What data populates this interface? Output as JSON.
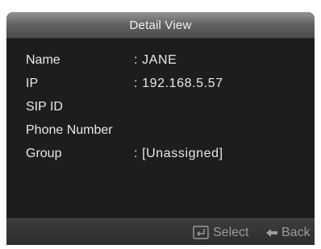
{
  "header": {
    "title": "Detail View"
  },
  "fields": [
    {
      "label": "Name",
      "value": ": JANE"
    },
    {
      "label": "IP",
      "value": ": 192.168.5.57"
    },
    {
      "label": "SIP ID",
      "value": ""
    },
    {
      "label": "Phone Number",
      "value": ""
    },
    {
      "label": "Group",
      "value": ": [Unassigned]"
    }
  ],
  "footer": {
    "select_label": "Select",
    "select_icon": "enter-key-icon",
    "back_label": "Back",
    "back_icon": "arrow-left-icon"
  },
  "colors": {
    "panel_background": "#1d1d20",
    "title_bar": "#6a6c6e",
    "text": "#e8e8e8",
    "hint_text": "#9a9c9e"
  }
}
